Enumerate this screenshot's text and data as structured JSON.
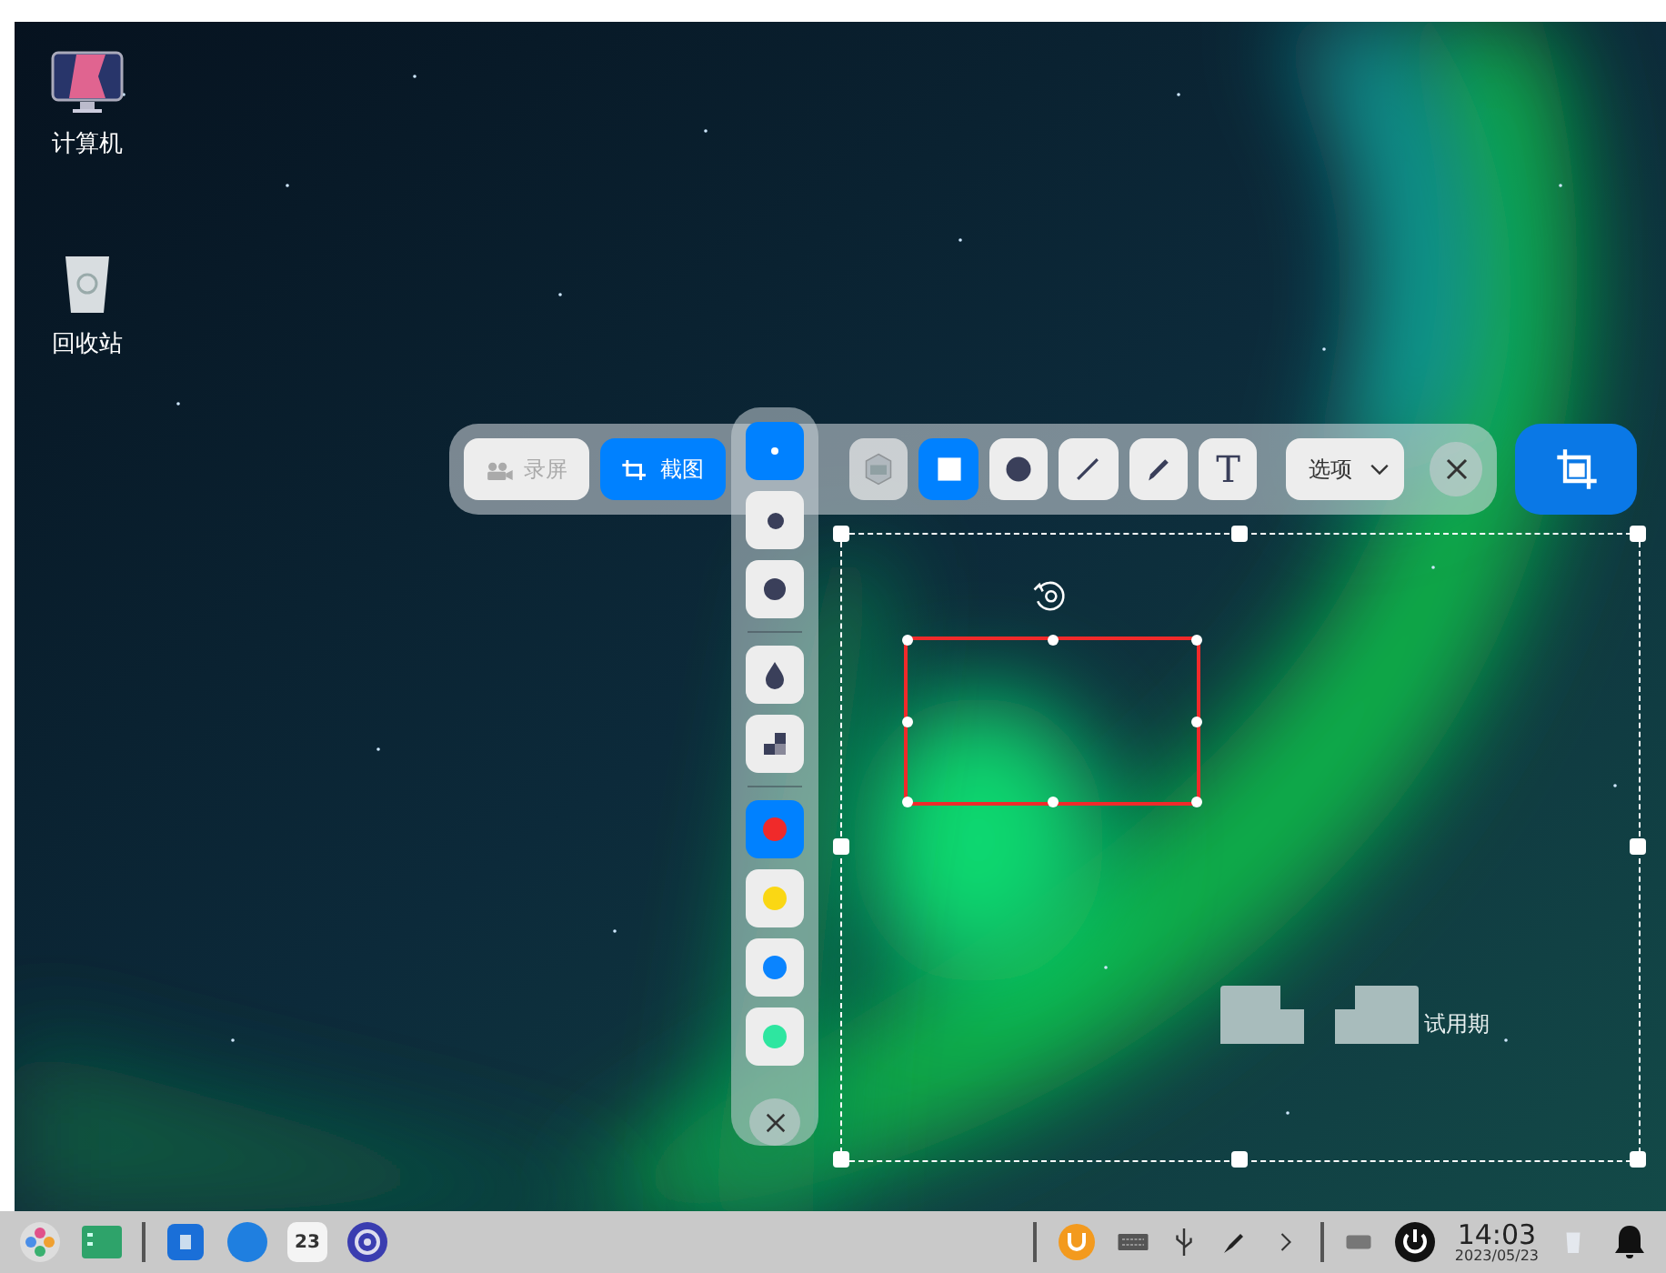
{
  "desktop_icons": [
    {
      "kind": "computer",
      "label": "计算机"
    },
    {
      "kind": "trash",
      "label": "回收站"
    }
  ],
  "toolbar": {
    "modes": [
      {
        "kind": "record",
        "label": "录屏",
        "selected": false
      },
      {
        "kind": "screenshot",
        "label": "截图",
        "selected": true
      }
    ],
    "tools": [
      {
        "kind": "blur",
        "selected": false
      },
      {
        "kind": "rect",
        "selected": true
      },
      {
        "kind": "ellipse",
        "selected": false
      },
      {
        "kind": "line",
        "selected": false
      },
      {
        "kind": "pen",
        "selected": false
      },
      {
        "kind": "text",
        "label": "T",
        "selected": false
      }
    ],
    "options": {
      "label": "选项"
    }
  },
  "side_panel": {
    "sizes": [
      {
        "kind": "small",
        "selected": true
      },
      {
        "kind": "medium",
        "selected": false
      },
      {
        "kind": "large",
        "selected": false
      }
    ],
    "effects": [
      {
        "kind": "blur",
        "selected": false
      },
      {
        "kind": "mosaic",
        "selected": false
      }
    ],
    "colors": [
      {
        "color": "#f02a2a",
        "selected": true
      },
      {
        "color": "#fad714",
        "selected": false
      },
      {
        "color": "#0a84ff",
        "selected": false
      },
      {
        "color": "#2ee6a0",
        "selected": false
      }
    ]
  },
  "selection": {
    "annotation_label": "试用期"
  },
  "taskbar": {
    "calendar_day": "23",
    "clock": {
      "time": "14:03",
      "date": "2023/05/23"
    }
  }
}
